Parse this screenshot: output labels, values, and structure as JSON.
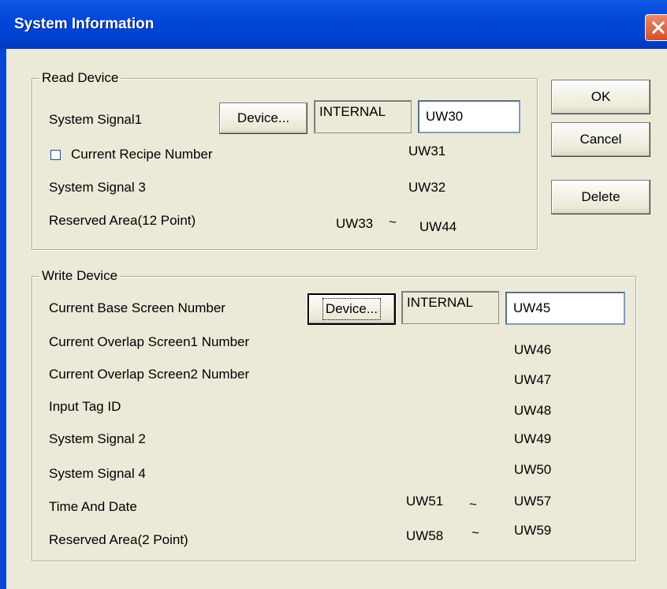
{
  "window": {
    "title": "System Information"
  },
  "buttons": {
    "ok": "OK",
    "cancel": "Cancel",
    "delete": "Delete"
  },
  "read_device": {
    "legend": "Read Device",
    "system_signal1": {
      "label": "System Signal1",
      "device_button": "Device...",
      "internal": "INTERNAL",
      "address": "UW30"
    },
    "current_recipe_number": {
      "label": "Current Recipe Number",
      "checked": false,
      "address": "UW31"
    },
    "system_signal3": {
      "label": "System Signal 3",
      "address": "UW32"
    },
    "reserved_area": {
      "label": "Reserved Area(12 Point)",
      "start": "UW33",
      "tilde": "~",
      "end": "UW44"
    }
  },
  "write_device": {
    "legend": "Write Device",
    "current_base_screen": {
      "label": "Current Base Screen Number",
      "device_button": "Device...",
      "internal": "INTERNAL",
      "address": "UW45"
    },
    "overlap1": {
      "label": "Current Overlap Screen1 Number",
      "address": "UW46"
    },
    "overlap2": {
      "label": "Current Overlap Screen2 Number",
      "address": "UW47"
    },
    "input_tag": {
      "label": "Input Tag ID",
      "address": "UW48"
    },
    "system_signal2": {
      "label": "System Signal 2",
      "address": "UW49"
    },
    "system_signal4": {
      "label": "System Signal 4",
      "address": "UW50"
    },
    "time_and_date": {
      "label": "Time And Date",
      "start": "UW51",
      "tilde": "~",
      "end": "UW57"
    },
    "reserved_area": {
      "label": "Reserved Area(2 Point)",
      "start": "UW58",
      "tilde": "~",
      "end": "UW59"
    }
  },
  "icons": {
    "close": "close-x-icon"
  },
  "colors": {
    "titlebar": "#0047d8",
    "close_button": "#d4502b",
    "dialog_bg": "#ece9d8"
  }
}
